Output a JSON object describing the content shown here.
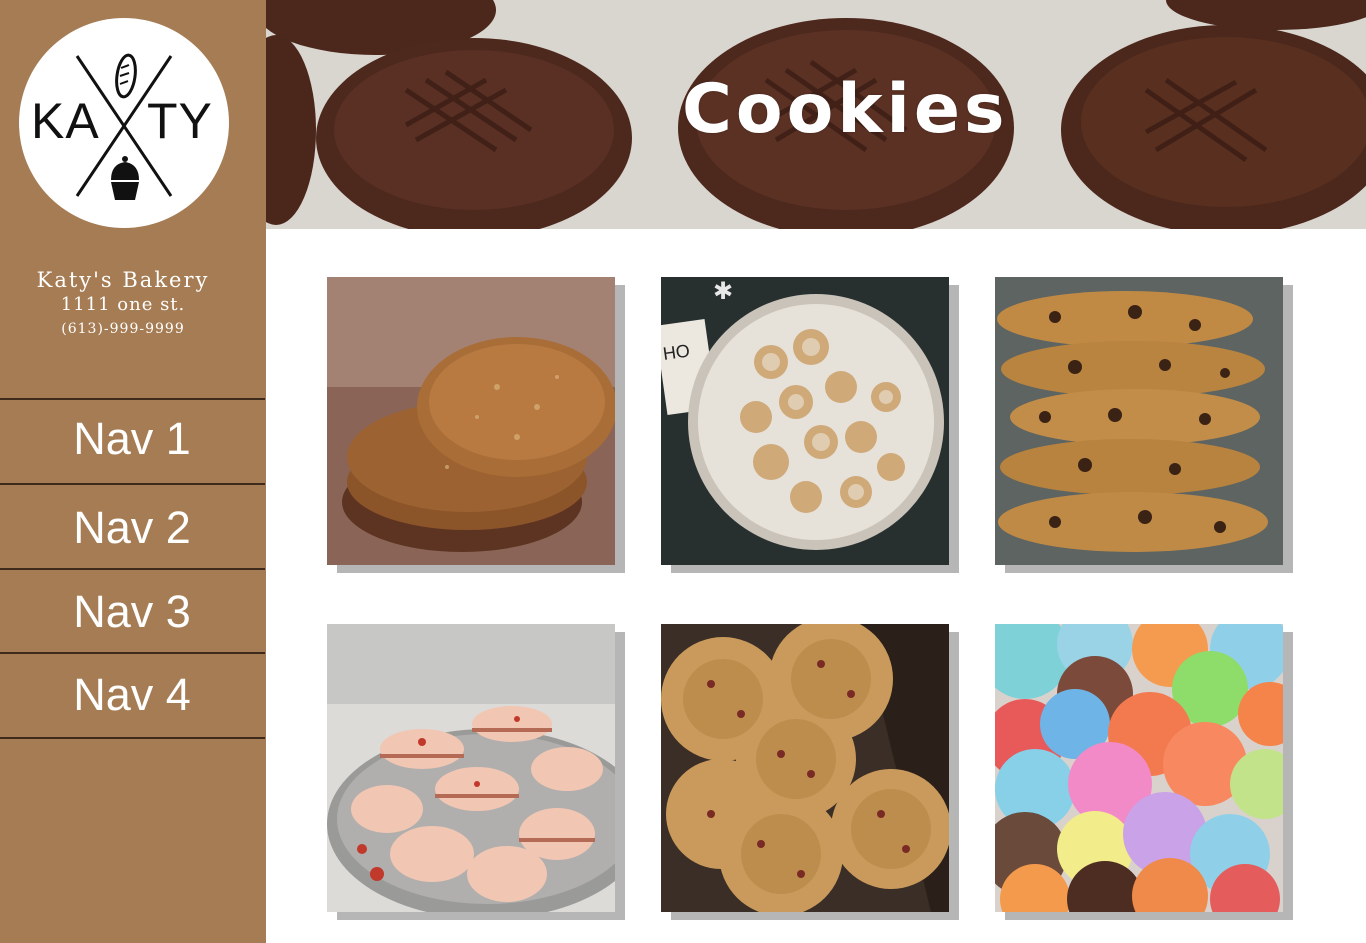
{
  "logo": {
    "left_text": "KA",
    "right_text": "TY"
  },
  "bakery": {
    "name": "Katy's Bakery",
    "address": "1111 one st.",
    "phone": "(613)-999-9999"
  },
  "nav": [
    {
      "label": "Nav 1"
    },
    {
      "label": "Nav 2"
    },
    {
      "label": "Nav 3"
    },
    {
      "label": "Nav 4"
    }
  ],
  "header": {
    "title": "Cookies"
  },
  "products": [
    {
      "image": "oatmeal-cookies-stack"
    },
    {
      "image": "star-heart-cookies-plate",
      "sign_text": "HO HO HO"
    },
    {
      "image": "chocolate-chip-cookies-stack"
    },
    {
      "image": "peach-macarons-bowl"
    },
    {
      "image": "cranberry-oat-cookies-box"
    },
    {
      "image": "colorful-macarons-pile"
    }
  ],
  "colors": {
    "sidebar": "#a57c53",
    "nav_divider": "#3e2b1b",
    "tile_shadow": "#b6b6b6"
  }
}
